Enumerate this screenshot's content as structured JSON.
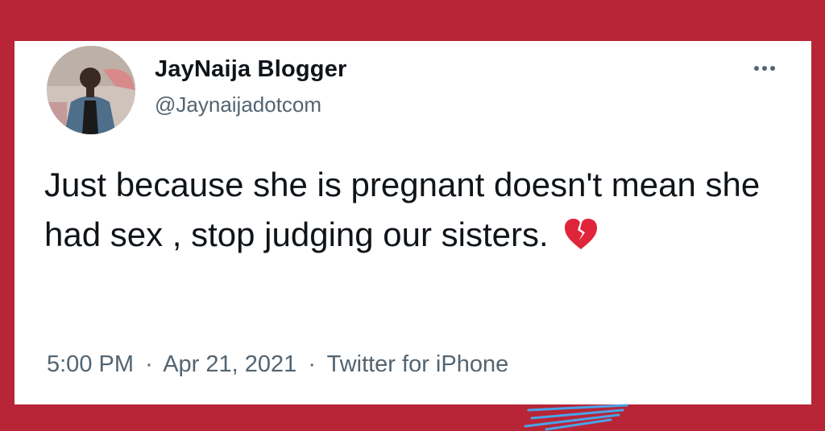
{
  "tweet": {
    "display_name": "JayNaija Blogger",
    "handle": "@Jaynaijadotcom",
    "text": "Just because she is pregnant doesn't mean she had sex , stop judging our sisters.",
    "emoji": "broken-heart-icon",
    "time": "5:00 PM",
    "separator": "·",
    "date": "Apr 21, 2021",
    "source": "Twitter for iPhone",
    "more_icon": "more-dots-icon"
  },
  "colors": {
    "background": "#b82536",
    "card": "#ffffff",
    "text_primary": "#0f1419",
    "text_secondary": "#536471",
    "heart": "#e0253b",
    "scribble": "#4aa3e8"
  }
}
